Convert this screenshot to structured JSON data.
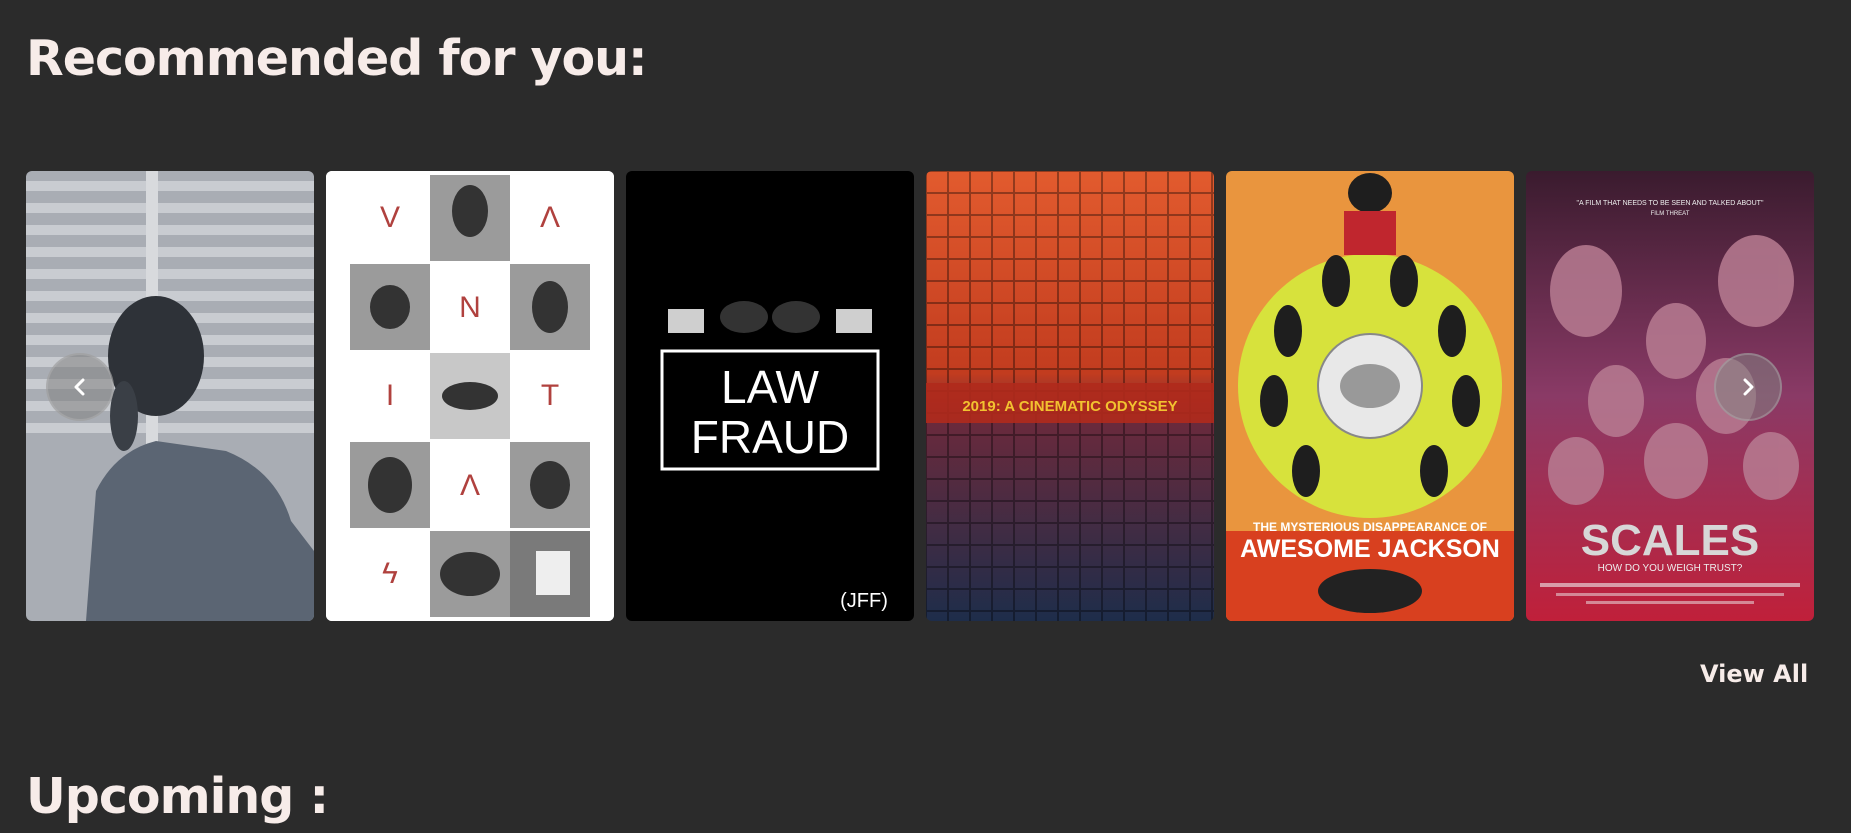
{
  "sections": {
    "recommended_title": "Recommended for you:",
    "upcoming_title": "Upcoming :"
  },
  "carousel": {
    "prev_icon": "chevron-left-icon",
    "next_icon": "chevron-right-icon",
    "view_all_label": "View All",
    "posters": [
      {
        "id": "man-on-phone",
        "text": ""
      },
      {
        "id": "vanitas",
        "letters": [
          "V",
          "A",
          "N",
          "I",
          "T",
          "A",
          "S"
        ]
      },
      {
        "id": "law-fraud",
        "title_line1": "LAW",
        "title_line2": "FRAUD",
        "badge": "(JFF)"
      },
      {
        "id": "cinematic-odyssey",
        "title": "2019: A CINEMATIC ODYSSEY"
      },
      {
        "id": "awesome-jackson",
        "title_small": "THE MYSTERIOUS DISAPPEARANCE OF",
        "title_large": "AWESOME JACKSON"
      },
      {
        "id": "scales",
        "tagline": "\"A FILM THAT NEEDS TO BE SEEN AND TALKED ABOUT\"",
        "tagline_source": "FILM THREAT",
        "title": "SCALES",
        "subtitle": "HOW DO YOU WEIGH TRUST?"
      }
    ]
  },
  "colors": {
    "background": "#2b2b2b",
    "heading": "#f7ece9"
  }
}
